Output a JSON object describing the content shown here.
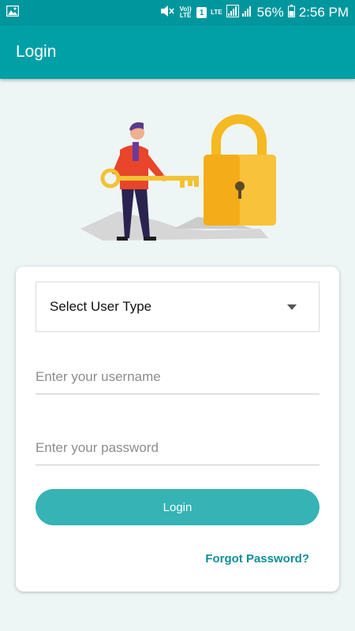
{
  "status_bar": {
    "volte_label": "Vo)) LTE",
    "sim_slot": "1",
    "lte_label": "LTE",
    "battery_percent": "56%",
    "time": "2:56 PM",
    "icons": [
      "image-icon",
      "mute-icon",
      "signal-icon",
      "battery-icon"
    ]
  },
  "app_bar": {
    "title": "Login"
  },
  "form": {
    "user_type_label": "Select User Type",
    "username_placeholder": "Enter your username",
    "password_placeholder": "Enter your password",
    "login_label": "Login",
    "forgot_label": "Forgot Password?"
  },
  "colors": {
    "primary": "#00a0a6",
    "status_bar": "#00969d",
    "button": "#35b3b5",
    "link": "#0e8f98",
    "background": "#eef5f5"
  }
}
